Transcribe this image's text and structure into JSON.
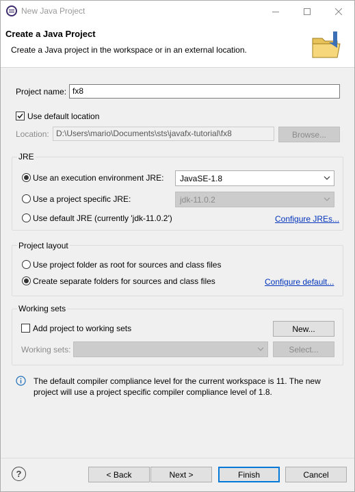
{
  "window": {
    "title": "New Java Project",
    "controls": {
      "minimize": "—",
      "maximize": "☐",
      "close": "✕"
    }
  },
  "banner": {
    "title": "Create a Java Project",
    "description": "Create a Java project in the workspace or in an external location."
  },
  "project": {
    "name_label": "Project name:",
    "name_value": "fx8",
    "use_default_location_label": "Use default location",
    "use_default_location_checked": true,
    "location_label": "Location:",
    "location_value": "D:\\Users\\mario\\Documents\\sts\\javafx-tutorial\\fx8",
    "browse_label": "Browse..."
  },
  "jre": {
    "group_title": "JRE",
    "options": [
      {
        "label": "Use an execution environment JRE:",
        "selected": true
      },
      {
        "label": "Use a project specific JRE:",
        "selected": false
      },
      {
        "label": "Use default JRE (currently 'jdk-11.0.2')",
        "selected": false
      }
    ],
    "execution_env_value": "JavaSE-1.8",
    "project_specific_value": "jdk-11.0.2",
    "configure_link": "Configure JREs..."
  },
  "layout": {
    "group_title": "Project layout",
    "options": [
      {
        "label": "Use project folder as root for sources and class files",
        "selected": false
      },
      {
        "label": "Create separate folders for sources and class files",
        "selected": true
      }
    ],
    "configure_link": "Configure default..."
  },
  "working_sets": {
    "group_title": "Working sets",
    "add_label": "Add project to working sets",
    "add_checked": false,
    "new_label": "New...",
    "sets_label": "Working sets:",
    "select_label": "Select..."
  },
  "info": {
    "icon": "info-icon",
    "line1": "The default compiler compliance level for the current workspace is 11. The new",
    "line2": "project will use a project specific compiler compliance level of 1.8."
  },
  "footer": {
    "help_icon": "?",
    "back_label": "< Back",
    "next_label": "Next >",
    "finish_label": "Finish",
    "cancel_label": "Cancel"
  },
  "colors": {
    "link": "#0033bb",
    "accent": "#0078d7",
    "info": "#1e6fb8"
  }
}
